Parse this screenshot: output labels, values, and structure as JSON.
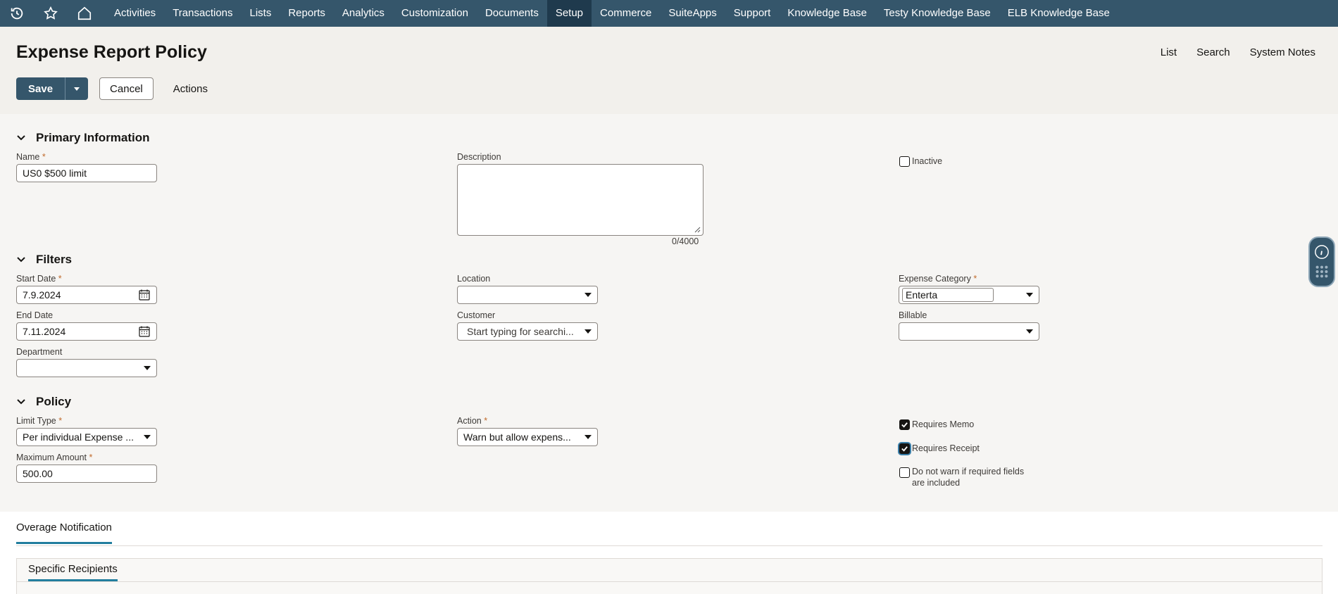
{
  "nav": {
    "icons": [
      "history-icon",
      "star-icon",
      "home-icon"
    ],
    "items": [
      "Activities",
      "Transactions",
      "Lists",
      "Reports",
      "Analytics",
      "Customization",
      "Documents",
      "Setup",
      "Commerce",
      "SuiteApps",
      "Support",
      "Knowledge Base",
      "Testy Knowledge Base",
      "ELB Knowledge Base"
    ],
    "active": "Setup"
  },
  "header": {
    "title": "Expense Report Policy",
    "links": [
      "List",
      "Search",
      "System Notes"
    ],
    "save_label": "Save",
    "cancel_label": "Cancel",
    "actions_label": "Actions"
  },
  "primary": {
    "title": "Primary Information",
    "name_label": "Name",
    "name_value": "US0 $500 limit",
    "description_label": "Description",
    "description_value": "",
    "description_counter": "0/4000",
    "inactive_label": "Inactive",
    "inactive_checked": false
  },
  "filters": {
    "title": "Filters",
    "start_date_label": "Start Date",
    "start_date_value": "7.9.2024",
    "end_date_label": "End Date",
    "end_date_value": "7.11.2024",
    "department_label": "Department",
    "department_value": "",
    "location_label": "Location",
    "location_value": "",
    "customer_label": "Customer",
    "customer_placeholder": "Start typing for searchi...",
    "expense_category_label": "Expense Category",
    "expense_category_value": "Enterta",
    "billable_label": "Billable",
    "billable_value": ""
  },
  "policy": {
    "title": "Policy",
    "limit_type_label": "Limit Type",
    "limit_type_value": "Per individual Expense ...",
    "max_amount_label": "Maximum Amount",
    "max_amount_value": "500.00",
    "action_label": "Action",
    "action_value": "Warn but allow expens...",
    "requires_memo_label": "Requires Memo",
    "requires_memo_checked": true,
    "requires_receipt_label": "Requires Receipt",
    "requires_receipt_checked": true,
    "no_warn_label_1": "Do not warn if required fields",
    "no_warn_label_2": "are included",
    "no_warn_checked": false
  },
  "tabs": {
    "main": "Overage Notification",
    "sub": "Specific Recipients"
  },
  "colors": {
    "nav_bg": "#35566b",
    "nav_active": "#1f3a4d",
    "primary_button": "#35566b",
    "tab_underline": "#227e9e",
    "required_asterisk": "#c06a2b"
  }
}
